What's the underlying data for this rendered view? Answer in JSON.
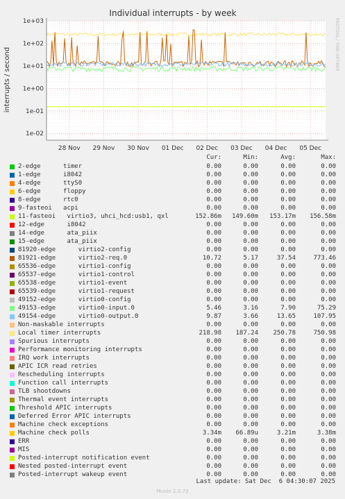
{
  "chart_data": {
    "type": "line",
    "title": "Individual interrupts - by week",
    "ylabel": "interrupts / second",
    "yscale": "log",
    "ylim": [
      0.005,
      1000
    ],
    "yticks": [
      {
        "v": 1000,
        "label": "1e+03"
      },
      {
        "v": 100,
        "label": "1e+02"
      },
      {
        "v": 10,
        "label": "1e+01"
      },
      {
        "v": 1,
        "label": "1e+00"
      },
      {
        "v": 0.1,
        "label": "1e-01"
      },
      {
        "v": 0.01,
        "label": "1e-02"
      }
    ],
    "xticks": [
      "28 Nov",
      "29 Nov",
      "30 Nov",
      "01 Dec",
      "02 Dec",
      "03 Dec",
      "04 Dec",
      "05 Dec"
    ],
    "grid": true,
    "side_text": "RRDTOOL / TOBI OETIKER",
    "series": [
      {
        "name": "Local timer interrupts",
        "color": "#ffe066",
        "base": 250,
        "spread": 0.15,
        "spikes": 0
      },
      {
        "name": "81921-edge virtio2-req.0",
        "color": "#cc6600",
        "base": 13,
        "spread": 0.3,
        "spikes": 1
      },
      {
        "name": "49154-edge virtio0-output.0",
        "color": "#80c0ff",
        "base": 12,
        "spread": 0.2,
        "spikes": 0
      },
      {
        "name": "49153-edge virtio0-input.0",
        "color": "#80ff80",
        "base": 7.5,
        "spread": 0.25,
        "spikes": 0
      },
      {
        "name": "11-fasteoi virtio3, uhci_hcd:usb1, qxl",
        "color": "#ccff00",
        "base": 0.153,
        "spread": 0.01,
        "spikes": 0
      },
      {
        "name": "Machine check polls",
        "color": "#ffcc00",
        "base": 0.0033,
        "spread": 0.02,
        "spikes": 0
      }
    ]
  },
  "legend": {
    "headers": [
      "Cur:",
      "Min:",
      "Avg:",
      "Max:"
    ],
    "rows": [
      {
        "color": "#00cc00",
        "label": "2-edge      timer",
        "cur": "0.00",
        "min": "0.00",
        "avg": "0.00",
        "max": "0.00"
      },
      {
        "color": "#0066b3",
        "label": "1-edge      i8042",
        "cur": "0.00",
        "min": "0.00",
        "avg": "0.00",
        "max": "0.00"
      },
      {
        "color": "#ff8000",
        "label": "4-edge      ttyS0",
        "cur": "0.00",
        "min": "0.00",
        "avg": "0.00",
        "max": "0.00"
      },
      {
        "color": "#ffcc00",
        "label": "6-edge      floppy",
        "cur": "0.00",
        "min": "0.00",
        "avg": "0.00",
        "max": "0.00"
      },
      {
        "color": "#330099",
        "label": "8-edge      rtc0",
        "cur": "0.00",
        "min": "0.00",
        "avg": "0.00",
        "max": "0.00"
      },
      {
        "color": "#990099",
        "label": "9-fasteoi   acpi",
        "cur": "0.00",
        "min": "0.00",
        "avg": "0.00",
        "max": "0.00"
      },
      {
        "color": "#ccff00",
        "label": "11-fasteoi   virtio3, uhci_hcd:usb1, qxl",
        "cur": "152.86m",
        "min": "149.60m",
        "avg": "153.17m",
        "max": "156.58m"
      },
      {
        "color": "#ff0000",
        "label": "12-edge      i8042",
        "cur": "0.00",
        "min": "0.00",
        "avg": "0.00",
        "max": "0.00"
      },
      {
        "color": "#808080",
        "label": "14-edge      ata_piix",
        "cur": "0.00",
        "min": "0.00",
        "avg": "0.00",
        "max": "0.00"
      },
      {
        "color": "#008f00",
        "label": "15-edge      ata_piix",
        "cur": "0.00",
        "min": "0.00",
        "avg": "0.00",
        "max": "0.00"
      },
      {
        "color": "#00487d",
        "label": "81920-edge      virtio2-config",
        "cur": "0.00",
        "min": "0.00",
        "avg": "0.00",
        "max": "0.00"
      },
      {
        "color": "#b35a00",
        "label": "81921-edge      virtio2-req.0",
        "cur": "10.72",
        "min": "5.17",
        "avg": "37.54",
        "max": "773.46"
      },
      {
        "color": "#b38f00",
        "label": "65536-edge      virtio1-config",
        "cur": "0.00",
        "min": "0.00",
        "avg": "0.00",
        "max": "0.00"
      },
      {
        "color": "#6b006b",
        "label": "65537-edge      virtio1-control",
        "cur": "0.00",
        "min": "0.00",
        "avg": "0.00",
        "max": "0.00"
      },
      {
        "color": "#8fb300",
        "label": "65538-edge      virtio1-event",
        "cur": "0.00",
        "min": "0.00",
        "avg": "0.00",
        "max": "0.00"
      },
      {
        "color": "#b30000",
        "label": "65539-edge      virtio1-request",
        "cur": "0.00",
        "min": "0.00",
        "avg": "0.00",
        "max": "0.00"
      },
      {
        "color": "#bebebe",
        "label": "49152-edge      virtio0-config",
        "cur": "0.00",
        "min": "0.00",
        "avg": "0.00",
        "max": "0.00"
      },
      {
        "color": "#80ff80",
        "label": "49153-edge      virtio0-input.0",
        "cur": "5.46",
        "min": "3.16",
        "avg": "7.90",
        "max": "75.29"
      },
      {
        "color": "#80c9ff",
        "label": "49154-edge      virtio0-output.0",
        "cur": "9.87",
        "min": "3.66",
        "avg": "13.65",
        "max": "107.95"
      },
      {
        "color": "#ffc080",
        "label": "Non-maskable interrupts",
        "cur": "0.00",
        "min": "0.00",
        "avg": "0.00",
        "max": "0.00"
      },
      {
        "color": "#ffe680",
        "label": "Local timer interrupts",
        "cur": "218.98",
        "min": "187.24",
        "avg": "250.78",
        "max": "750.98"
      },
      {
        "color": "#aa80ff",
        "label": "Spurious interrupts",
        "cur": "0.00",
        "min": "0.00",
        "avg": "0.00",
        "max": "0.00"
      },
      {
        "color": "#ee00cc",
        "label": "Performance monitoring interrupts",
        "cur": "0.00",
        "min": "0.00",
        "avg": "0.00",
        "max": "0.00"
      },
      {
        "color": "#ff8080",
        "label": "IRQ work interrupts",
        "cur": "0.00",
        "min": "0.00",
        "avg": "0.00",
        "max": "0.00"
      },
      {
        "color": "#666600",
        "label": "APIC ICR read retries",
        "cur": "0.00",
        "min": "0.00",
        "avg": "0.00",
        "max": "0.00"
      },
      {
        "color": "#ffbfff",
        "label": "Rescheduling interrupts",
        "cur": "0.00",
        "min": "0.00",
        "avg": "0.00",
        "max": "0.00"
      },
      {
        "color": "#00ffcc",
        "label": "Function call interrupts",
        "cur": "0.00",
        "min": "0.00",
        "avg": "0.00",
        "max": "0.00"
      },
      {
        "color": "#cc6699",
        "label": "TLB shootdowns",
        "cur": "0.00",
        "min": "0.00",
        "avg": "0.00",
        "max": "0.00"
      },
      {
        "color": "#999900",
        "label": "Thermal event interrupts",
        "cur": "0.00",
        "min": "0.00",
        "avg": "0.00",
        "max": "0.00"
      },
      {
        "color": "#00cc00",
        "label": "Threshold APIC interrupts",
        "cur": "0.00",
        "min": "0.00",
        "avg": "0.00",
        "max": "0.00"
      },
      {
        "color": "#0066b3",
        "label": "Deferred Error APIC interrupts",
        "cur": "0.00",
        "min": "0.00",
        "avg": "0.00",
        "max": "0.00"
      },
      {
        "color": "#ff8000",
        "label": "Machine check exceptions",
        "cur": "0.00",
        "min": "0.00",
        "avg": "0.00",
        "max": "0.00"
      },
      {
        "color": "#ffcc00",
        "label": "Machine check polls",
        "cur": "3.34m",
        "min": "66.89u",
        "avg": "3.21m",
        "max": "3.38m"
      },
      {
        "color": "#330099",
        "label": "ERR",
        "cur": "0.00",
        "min": "0.00",
        "avg": "0.00",
        "max": "0.00"
      },
      {
        "color": "#990099",
        "label": "MIS",
        "cur": "0.00",
        "min": "0.00",
        "avg": "0.00",
        "max": "0.00"
      },
      {
        "color": "#ccff00",
        "label": "Posted-interrupt notification event",
        "cur": "0.00",
        "min": "0.00",
        "avg": "0.00",
        "max": "0.00"
      },
      {
        "color": "#ff0000",
        "label": "Nested posted-interrupt event",
        "cur": "0.00",
        "min": "0.00",
        "avg": "0.00",
        "max": "0.00"
      },
      {
        "color": "#808080",
        "label": "Posted-interrupt wakeup event",
        "cur": "0.00",
        "min": "0.00",
        "avg": "0.00",
        "max": "0.00"
      }
    ]
  },
  "footer": {
    "last_update": "Last update: Sat Dec  6 04:30:07 2025",
    "generator": "Munin 2.0.73"
  }
}
